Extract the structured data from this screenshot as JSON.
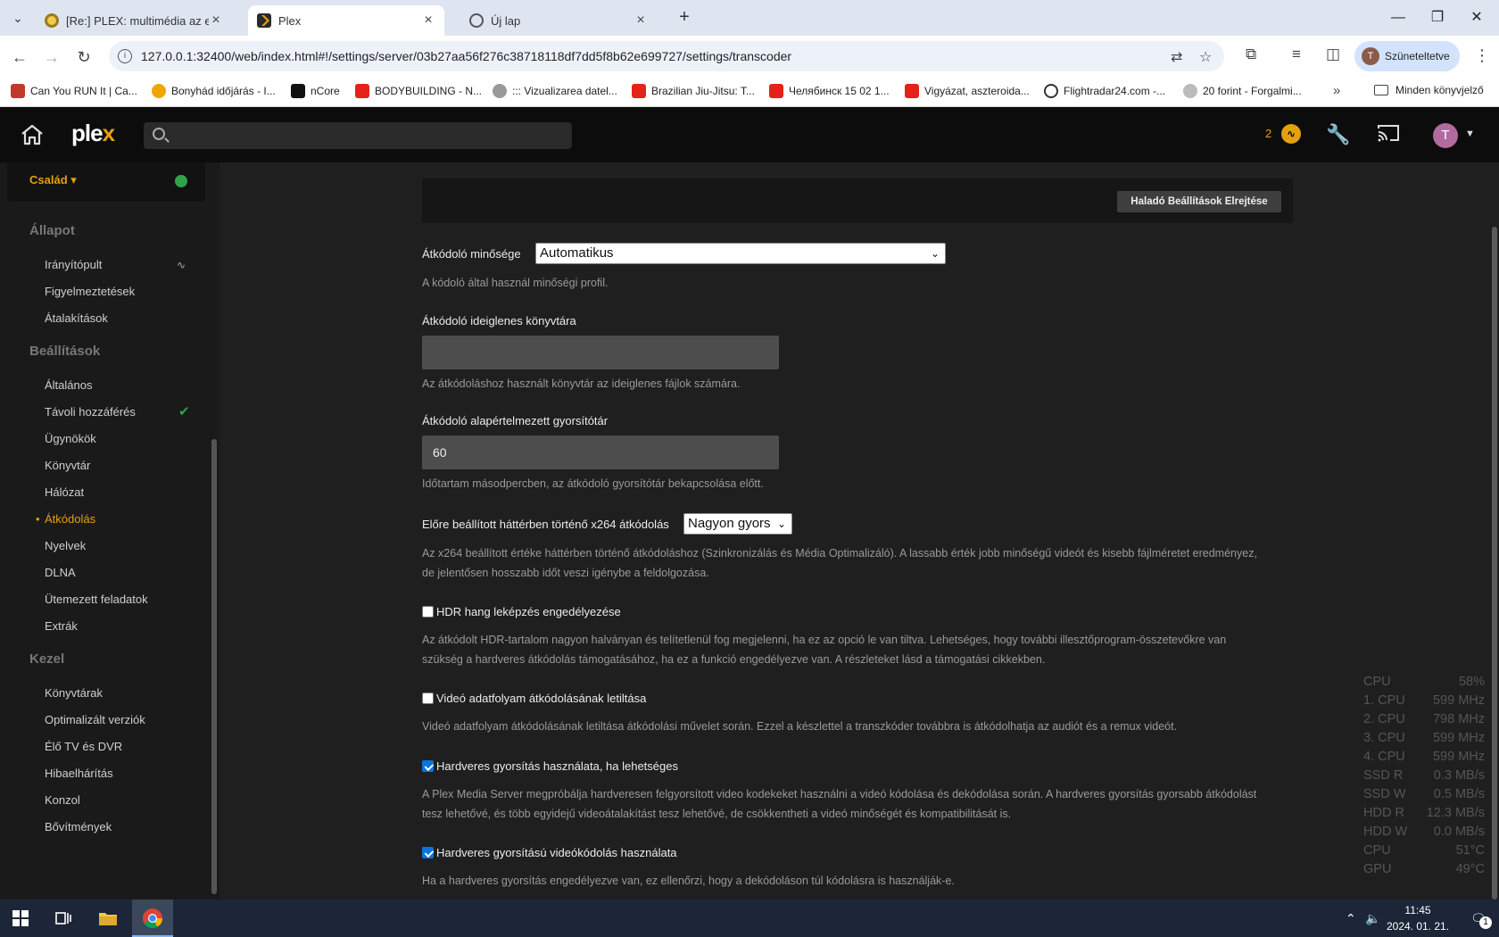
{
  "browser": {
    "tabs": [
      {
        "title": "[Re:] PLEX: multimédia az egész..."
      },
      {
        "title": "Plex"
      },
      {
        "title": "Új lap"
      }
    ],
    "url": "127.0.0.1:32400/web/index.html#!/settings/server/03b27aa56f276c38718118df7dd5f8b62e699727/settings/transcoder",
    "profile_label": "Szüneteltetve",
    "profile_initial": "T",
    "bookmarks": [
      "Can You RUN It | Ca...",
      "Bonyhád időjárás - I...",
      "nCore",
      "BODYBUILDING - N...",
      "::: Vizualizarea datel...",
      "Brazilian Jiu-Jitsu: T...",
      "Челябинск 15 02 1...",
      "Vigyázat, aszteroida...",
      "Flightradar24.com -...",
      "20 forint - Forgalmi..."
    ],
    "all_bookmarks": "Minden könyvjelző"
  },
  "plex": {
    "logo_main": "ple",
    "logo_accent": "x",
    "activity_count": "2",
    "user_initial": "T",
    "server_name": "Család",
    "sections": {
      "status": "Állapot",
      "settings": "Beállítások",
      "manage": "Kezel"
    },
    "status_items": [
      "Irányítópult",
      "Figyelmeztetések",
      "Átalakítások"
    ],
    "settings_items": [
      "Általános",
      "Távoli hozzáférés",
      "Ügynökök",
      "Könyvtár",
      "Hálózat",
      "Átkódolás",
      "Nyelvek",
      "DLNA",
      "Ütemezett feladatok",
      "Extrák"
    ],
    "manage_items": [
      "Könyvtárak",
      "Optimalizált verziók",
      "Élő TV és DVR",
      "Hibaelhárítás",
      "Konzol",
      "Bővítmények"
    ],
    "advanced_button": "Haladó Beállítások Elrejtése",
    "settings": {
      "quality_label": "Átkódoló minősége",
      "quality_value": "Automatikus",
      "quality_help": "A kódoló által használ minőségi profil.",
      "tempdir_label": "Átkódoló ideiglenes könyvtára",
      "tempdir_value": "",
      "tempdir_help": "Az átkódoláshoz használt könyvtár az ideiglenes fájlok számára.",
      "buffer_label": "Átkódoló alapértelmezett gyorsítótár",
      "buffer_value": "60",
      "buffer_help": "Időtartam másodpercben, az átkódoló gyorsítótár bekapcsolása előtt.",
      "x264_label": "Előre beállított háttérben történő x264 átkódolás",
      "x264_value": "Nagyon gyors",
      "x264_help_1": "Az x264 beállított értéke háttérben történő átkódoláshoz (Szinkronizálás és Média Optimalizáló). A lassabb érték jobb minőségű videót és kisebb fájlméretet eredményez,",
      "x264_help_2": "de jelentősen hosszabb időt veszi igénybe a feldolgozása.",
      "hdr_label": "HDR hang leképzés engedélyezése",
      "hdr_checked": false,
      "hdr_help_1": "Az átkódolt HDR-tartalom nagyon halványan és telítetlenül fog megjelenni, ha ez az opció le van tiltva. Lehetséges, hogy további illesztőprogram-összetevőkre van",
      "hdr_help_2": "szükség a hardveres átkódolás támogatásához, ha ez a funkció engedélyezve van. A részleteket lásd a támogatási cikkekben.",
      "disable_video_label": "Videó adatfolyam átkódolásának letiltása",
      "disable_video_checked": false,
      "disable_video_help": "Videó adatfolyam átkódolásának letiltása átkódolási művelet során. Ezzel a készlettel a transzkóder továbbra is átkódolhatja az audiót és a remux videót.",
      "hw_accel_label": "Hardveres gyorsítás használata, ha lehetséges",
      "hw_accel_checked": true,
      "hw_accel_help_1": "A Plex Media Server megpróbálja hardveresen felgyorsított video kodekeket használni a videó kódolása és dekódolása során. A hardveres gyorsítás gyorsabb átkódolást",
      "hw_accel_help_2": "tesz lehetővé, és több egyidejű videoátalakítást tesz lehetővé, de csökkentheti a videó minőségét és kompatibilitását is.",
      "hw_encode_label": "Hardveres gyorsítású videókódolás használata",
      "hw_encode_checked": true,
      "hw_encode_help": "Ha a hardveres gyorsítás engedélyezve van, ez ellenőrzi, hogy a dekódoláson túl kódolásra is használják-e."
    }
  },
  "overlay_stats": [
    {
      "label": "CPU",
      "value": "58%"
    },
    {
      "label": "1. CPU",
      "value": "599 MHz"
    },
    {
      "label": "2. CPU",
      "value": "798 MHz"
    },
    {
      "label": "3. CPU",
      "value": "599 MHz"
    },
    {
      "label": "4. CPU",
      "value": "599 MHz"
    },
    {
      "label": "SSD R",
      "value": "0.3 MB/s"
    },
    {
      "label": "SSD W",
      "value": "0.5 MB/s"
    },
    {
      "label": "HDD R",
      "value": "12.3 MB/s"
    },
    {
      "label": "HDD W",
      "value": "0.0 MB/s"
    },
    {
      "label": "CPU",
      "value": "51°C"
    },
    {
      "label": "GPU",
      "value": "49°C"
    }
  ],
  "taskbar": {
    "time": "11:45",
    "date": "2024. 01. 21.",
    "notifications": "1"
  }
}
